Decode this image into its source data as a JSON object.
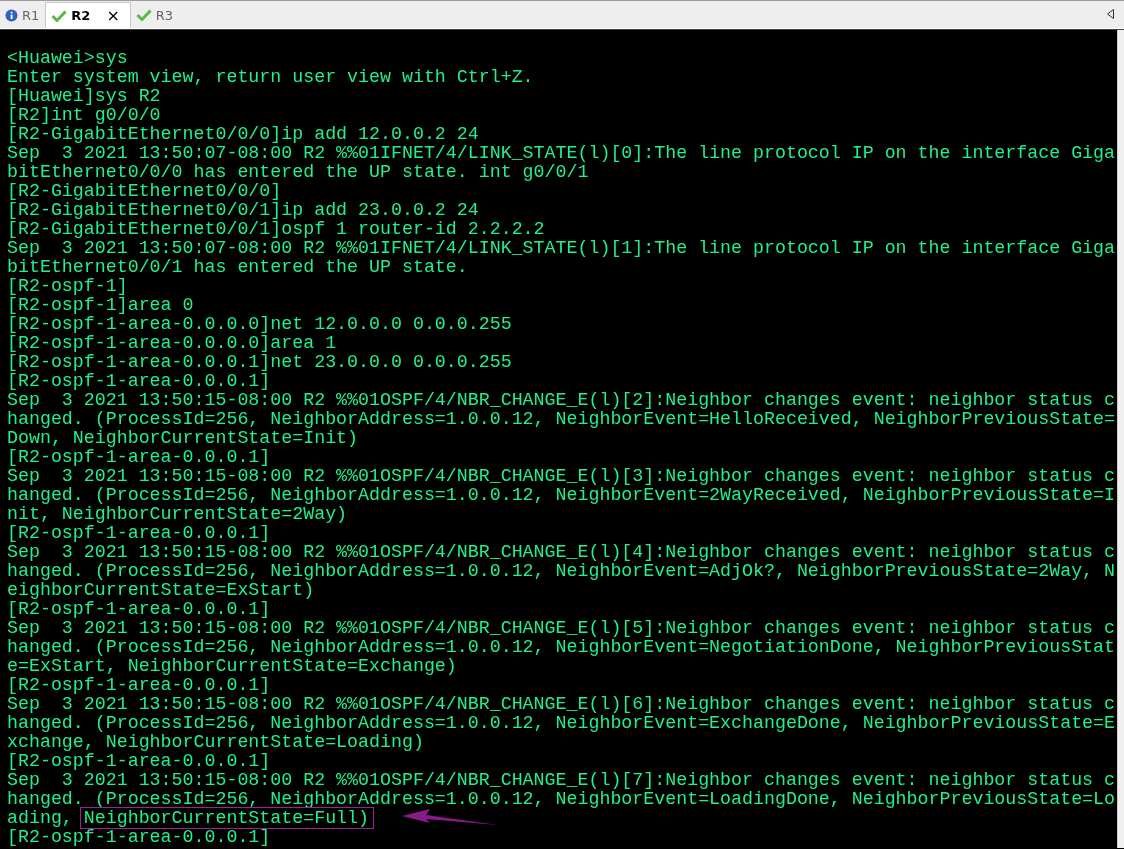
{
  "tabs": [
    {
      "label": "R1",
      "kind": "info",
      "selected": false,
      "closable": false
    },
    {
      "label": "R2",
      "kind": "ok",
      "selected": true,
      "closable": true,
      "close_glyph": "×"
    },
    {
      "label": "R3",
      "kind": "ok",
      "selected": false,
      "closable": false
    }
  ],
  "terminal": {
    "lines": [
      {
        "kind": "text",
        "text": "<Huawei>sys"
      },
      {
        "kind": "text",
        "text": "Enter system view, return user view with Ctrl+Z."
      },
      {
        "kind": "text",
        "text": "[Huawei]sys R2"
      },
      {
        "kind": "text",
        "text": "[R2]int g0/0/0"
      },
      {
        "kind": "text",
        "text": "[R2-GigabitEthernet0/0/0]ip add 12.0.0.2 24"
      },
      {
        "kind": "text",
        "text": "Sep  3 2021 13:50:07-08:00 R2 %%01IFNET/4/LINK_STATE(l)[0]:The line protocol IP on the interface Giga"
      },
      {
        "kind": "text",
        "text": "bitEthernet0/0/0 has entered the UP state. int g0/0/1"
      },
      {
        "kind": "text",
        "text": "[R2-GigabitEthernet0/0/0]"
      },
      {
        "kind": "text",
        "text": "[R2-GigabitEthernet0/0/1]ip add 23.0.0.2 24"
      },
      {
        "kind": "text",
        "text": "[R2-GigabitEthernet0/0/1]ospf 1 router-id 2.2.2.2"
      },
      {
        "kind": "text",
        "text": "Sep  3 2021 13:50:07-08:00 R2 %%01IFNET/4/LINK_STATE(l)[1]:The line protocol IP on the interface Giga"
      },
      {
        "kind": "text",
        "text": "bitEthernet0/0/1 has entered the UP state."
      },
      {
        "kind": "text",
        "text": "[R2-ospf-1]"
      },
      {
        "kind": "text",
        "text": "[R2-ospf-1]area 0"
      },
      {
        "kind": "text",
        "text": "[R2-ospf-1-area-0.0.0.0]net 12.0.0.0 0.0.0.255"
      },
      {
        "kind": "text",
        "text": "[R2-ospf-1-area-0.0.0.0]area 1"
      },
      {
        "kind": "text",
        "text": "[R2-ospf-1-area-0.0.0.1]net 23.0.0.0 0.0.0.255"
      },
      {
        "kind": "text",
        "text": "[R2-ospf-1-area-0.0.0.1]"
      },
      {
        "kind": "text",
        "text": "Sep  3 2021 13:50:15-08:00 R2 %%01OSPF/4/NBR_CHANGE_E(l)[2]:Neighbor changes event: neighbor status c"
      },
      {
        "kind": "text",
        "text": "hanged. (ProcessId=256, NeighborAddress=1.0.0.12, NeighborEvent=HelloReceived, NeighborPreviousState="
      },
      {
        "kind": "text",
        "text": "Down, NeighborCurrentState=Init)"
      },
      {
        "kind": "text",
        "text": "[R2-ospf-1-area-0.0.0.1]"
      },
      {
        "kind": "text",
        "text": "Sep  3 2021 13:50:15-08:00 R2 %%01OSPF/4/NBR_CHANGE_E(l)[3]:Neighbor changes event: neighbor status c"
      },
      {
        "kind": "text",
        "text": "hanged. (ProcessId=256, NeighborAddress=1.0.0.12, NeighborEvent=2WayReceived, NeighborPreviousState=I"
      },
      {
        "kind": "text",
        "text": "nit, NeighborCurrentState=2Way)"
      },
      {
        "kind": "text",
        "text": "[R2-ospf-1-area-0.0.0.1]"
      },
      {
        "kind": "text",
        "text": "Sep  3 2021 13:50:15-08:00 R2 %%01OSPF/4/NBR_CHANGE_E(l)[4]:Neighbor changes event: neighbor status c"
      },
      {
        "kind": "text",
        "text": "hanged. (ProcessId=256, NeighborAddress=1.0.0.12, NeighborEvent=AdjOk?, NeighborPreviousState=2Way, N"
      },
      {
        "kind": "text",
        "text": "eighborCurrentState=ExStart)"
      },
      {
        "kind": "text",
        "text": "[R2-ospf-1-area-0.0.0.1]"
      },
      {
        "kind": "text",
        "text": "Sep  3 2021 13:50:15-08:00 R2 %%01OSPF/4/NBR_CHANGE_E(l)[5]:Neighbor changes event: neighbor status c"
      },
      {
        "kind": "text",
        "text": "hanged. (ProcessId=256, NeighborAddress=1.0.0.12, NeighborEvent=NegotiationDone, NeighborPreviousStat"
      },
      {
        "kind": "text",
        "text": "e=ExStart, NeighborCurrentState=Exchange)"
      },
      {
        "kind": "text",
        "text": "[R2-ospf-1-area-0.0.0.1]"
      },
      {
        "kind": "text",
        "text": "Sep  3 2021 13:50:15-08:00 R2 %%01OSPF/4/NBR_CHANGE_E(l)[6]:Neighbor changes event: neighbor status c"
      },
      {
        "kind": "text",
        "text": "hanged. (ProcessId=256, NeighborAddress=1.0.0.12, NeighborEvent=ExchangeDone, NeighborPreviousState=E"
      },
      {
        "kind": "text",
        "text": "xchange, NeighborCurrentState=Loading)"
      },
      {
        "kind": "text",
        "text": "[R2-ospf-1-area-0.0.0.1]"
      },
      {
        "kind": "text",
        "text": "Sep  3 2021 13:50:15-08:00 R2 %%01OSPF/4/NBR_CHANGE_E(l)[7]:Neighbor changes event: neighbor status c"
      },
      {
        "kind": "text",
        "text": "hanged. (ProcessId=256, NeighborAddress=1.0.0.12, NeighborEvent=LoadingDone, NeighborPreviousState=Lo"
      },
      {
        "kind": "marked",
        "text": "ading, ",
        "marked": "NeighborCurrentState=Full)"
      },
      {
        "kind": "text",
        "text": "[R2-ospf-1-area-0.0.0.1]"
      }
    ]
  }
}
